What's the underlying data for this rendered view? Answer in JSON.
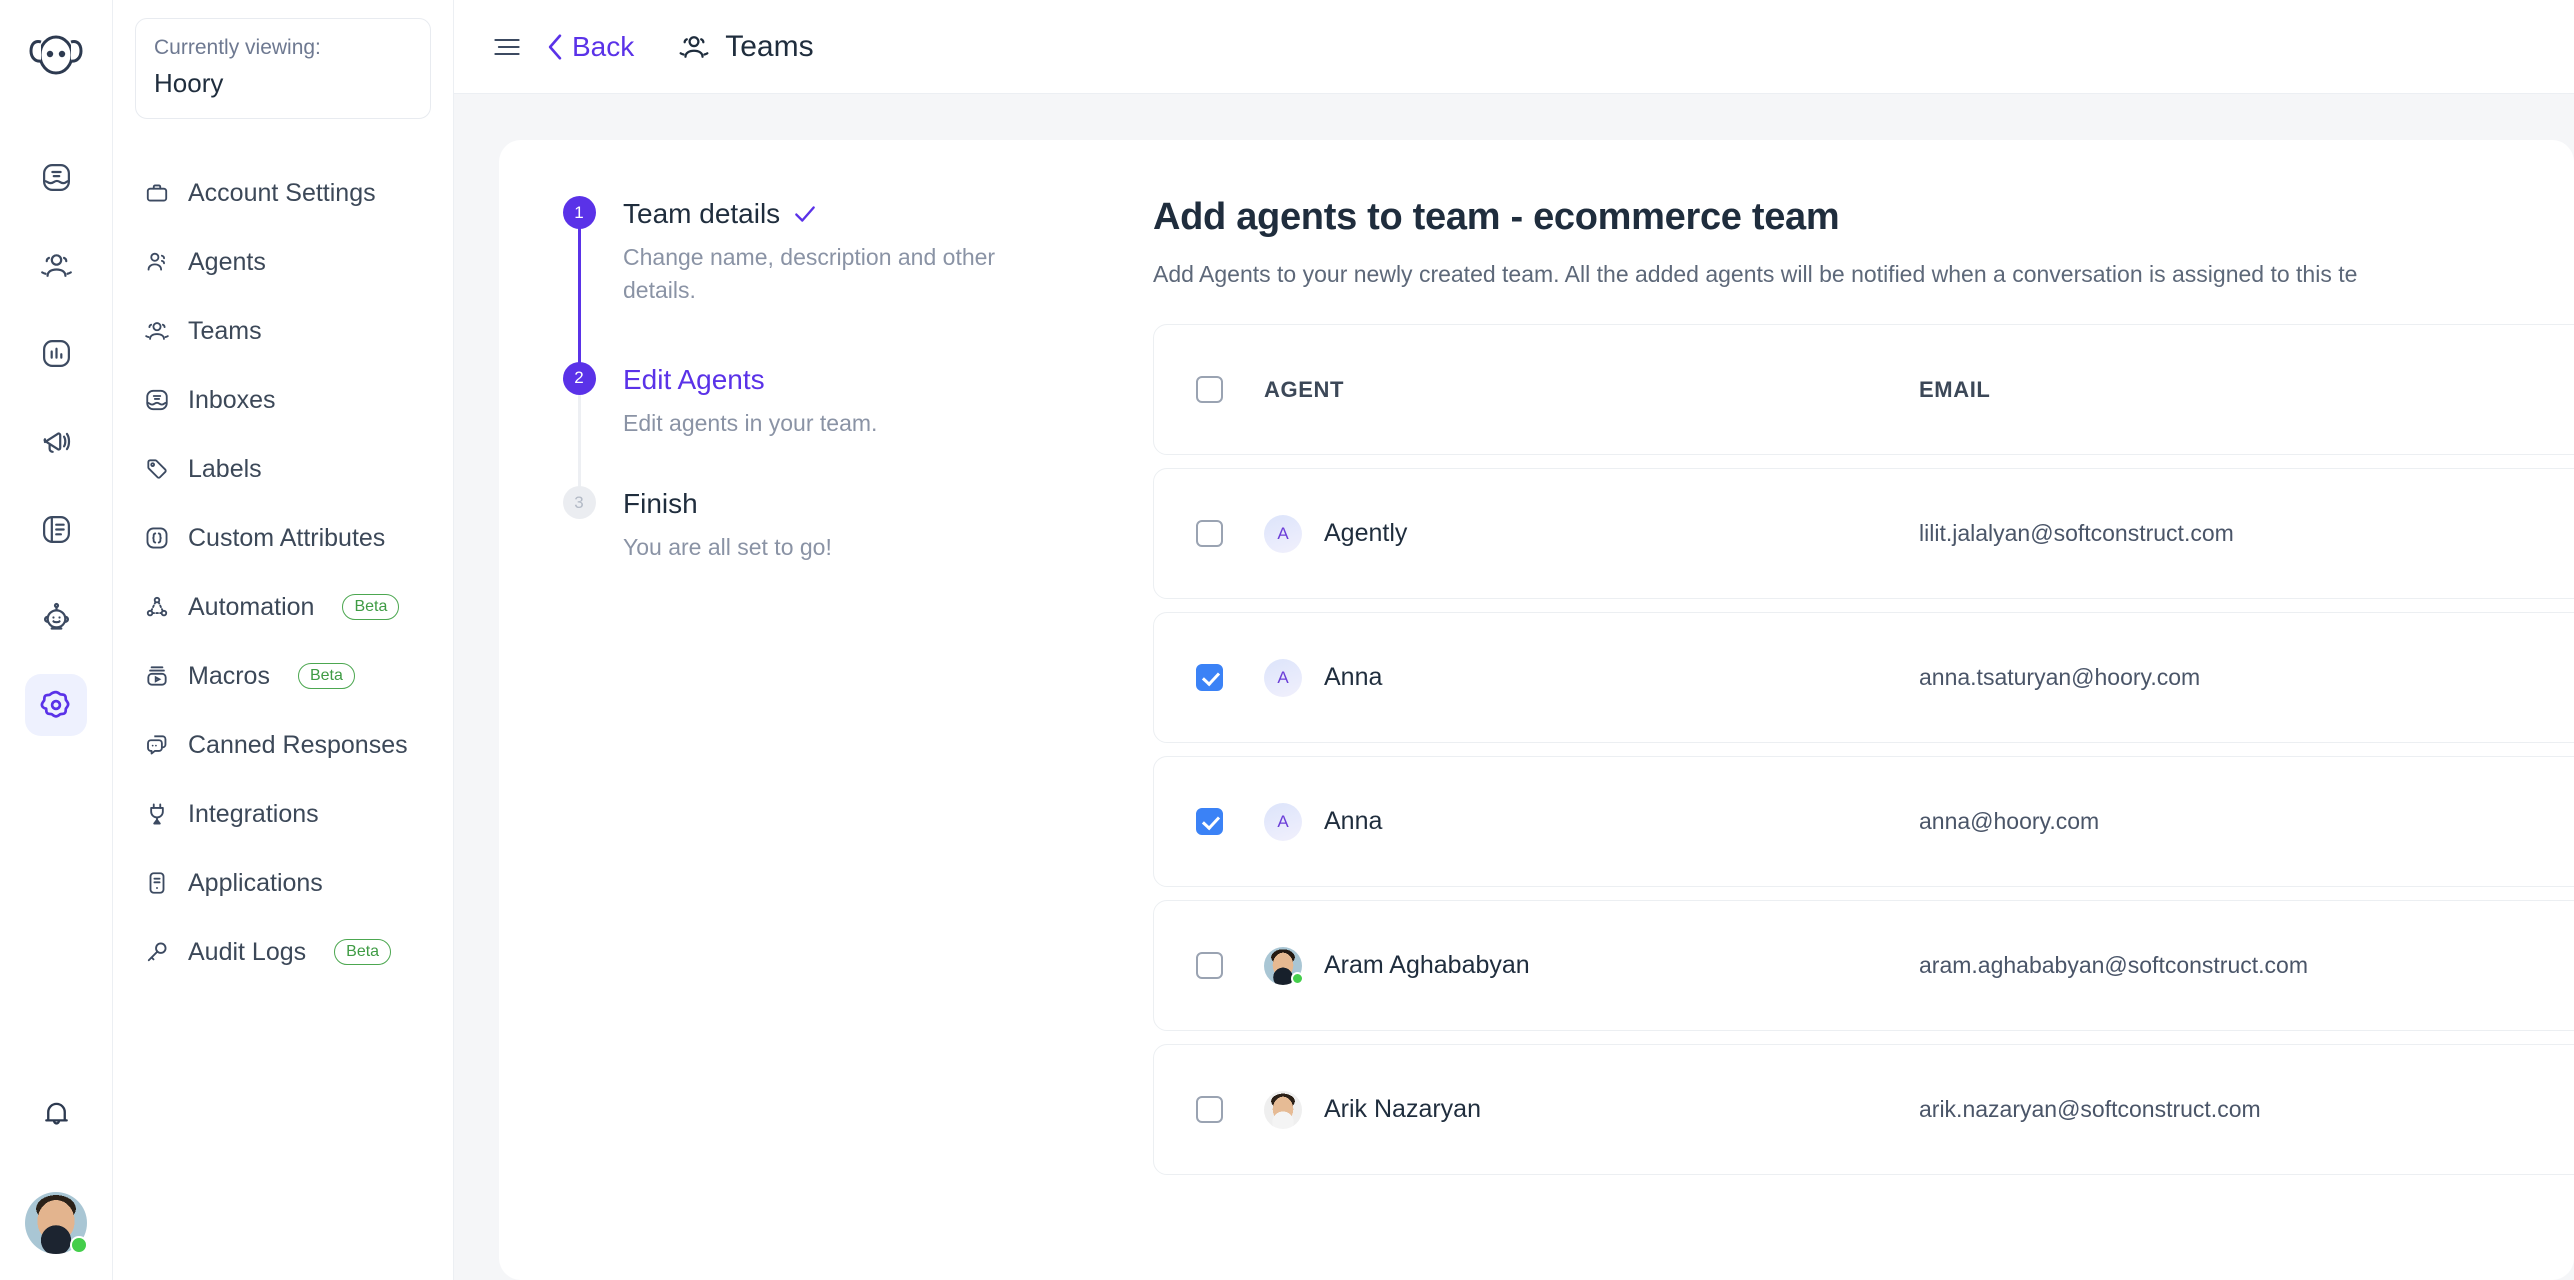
{
  "colors": {
    "brand_purple": "#5A32E8",
    "checkbox_blue": "#3B82F6",
    "beta_green": "#3F9B44",
    "online_green": "#44CE4B",
    "canvas_gray": "#F5F6F8",
    "text_dark": "#1F2D3D",
    "text_muted": "#8A93A5"
  },
  "rail": {
    "logo": "hoory-logo-icon",
    "items": [
      {
        "name": "conversations",
        "icon": "inbox-icon",
        "active": false
      },
      {
        "name": "contacts",
        "icon": "people-icon",
        "active": false
      },
      {
        "name": "reports",
        "icon": "bar-chart-icon",
        "active": false
      },
      {
        "name": "campaigns",
        "icon": "megaphone-icon",
        "active": false
      },
      {
        "name": "knowledge-base",
        "icon": "book-icon",
        "active": false
      },
      {
        "name": "assistant",
        "icon": "robot-icon",
        "active": false
      },
      {
        "name": "settings",
        "icon": "gear-icon",
        "active": true
      }
    ],
    "bell": "bell-icon",
    "avatar_status": "online"
  },
  "sidebar": {
    "viewing_label": "Currently viewing:",
    "account_name": "Hoory",
    "items": [
      {
        "label": "Account Settings",
        "icon": "briefcase-icon",
        "badge": ""
      },
      {
        "label": "Agents",
        "icon": "person-group-icon",
        "badge": ""
      },
      {
        "label": "Teams",
        "icon": "teams-icon",
        "badge": ""
      },
      {
        "label": "Inboxes",
        "icon": "inbox-icon",
        "badge": ""
      },
      {
        "label": "Labels",
        "icon": "tag-icon",
        "badge": ""
      },
      {
        "label": "Custom Attributes",
        "icon": "braces-icon",
        "badge": ""
      },
      {
        "label": "Automation",
        "icon": "automation-icon",
        "badge": "Beta"
      },
      {
        "label": "Macros",
        "icon": "macros-icon",
        "badge": "Beta"
      },
      {
        "label": "Canned Responses",
        "icon": "chat-icon",
        "badge": ""
      },
      {
        "label": "Integrations",
        "icon": "plug-icon",
        "badge": ""
      },
      {
        "label": "Applications",
        "icon": "app-icon",
        "badge": ""
      },
      {
        "label": "Audit Logs",
        "icon": "key-icon",
        "badge": "Beta"
      }
    ]
  },
  "topbar": {
    "menu_icon": "hamburger-icon",
    "back_label": "Back",
    "back_icon": "chevron-left-icon",
    "title_icon": "teams-icon",
    "title": "Teams"
  },
  "wizard": {
    "steps": [
      {
        "number": "1",
        "title": "Team details",
        "desc": "Change name, description and other details.",
        "state": "completed",
        "check_icon": "check-icon"
      },
      {
        "number": "2",
        "title": "Edit Agents",
        "desc": "Edit agents in your team.",
        "state": "current",
        "check_icon": ""
      },
      {
        "number": "3",
        "title": "Finish",
        "desc": "You are all set to go!",
        "state": "upcoming",
        "check_icon": ""
      }
    ]
  },
  "pane": {
    "title": "Add agents to team - ecommerce team",
    "subtitle": "Add Agents to your newly created team. All the added agents will be notified when a conversation is assigned to this te",
    "table": {
      "select_all_checked": false,
      "columns": [
        "AGENT",
        "EMAIL"
      ],
      "rows": [
        {
          "checked": false,
          "avatar_type": "initial",
          "initial": "A",
          "name": "Agently",
          "email": "lilit.jalalyan@softconstruct.com",
          "online": false
        },
        {
          "checked": true,
          "avatar_type": "initial",
          "initial": "A",
          "name": "Anna",
          "email": "anna.tsaturyan@hoory.com",
          "online": false
        },
        {
          "checked": true,
          "avatar_type": "initial",
          "initial": "A",
          "name": "Anna",
          "email": "anna@hoory.com",
          "online": false
        },
        {
          "checked": false,
          "avatar_type": "p-aram",
          "initial": "",
          "name": "Aram Aghababyan",
          "email": "aram.aghababyan@softconstruct.com",
          "online": true
        },
        {
          "checked": false,
          "avatar_type": "p-arik",
          "initial": "",
          "name": "Arik Nazaryan",
          "email": "arik.nazaryan@softconstruct.com",
          "online": false
        }
      ]
    }
  }
}
